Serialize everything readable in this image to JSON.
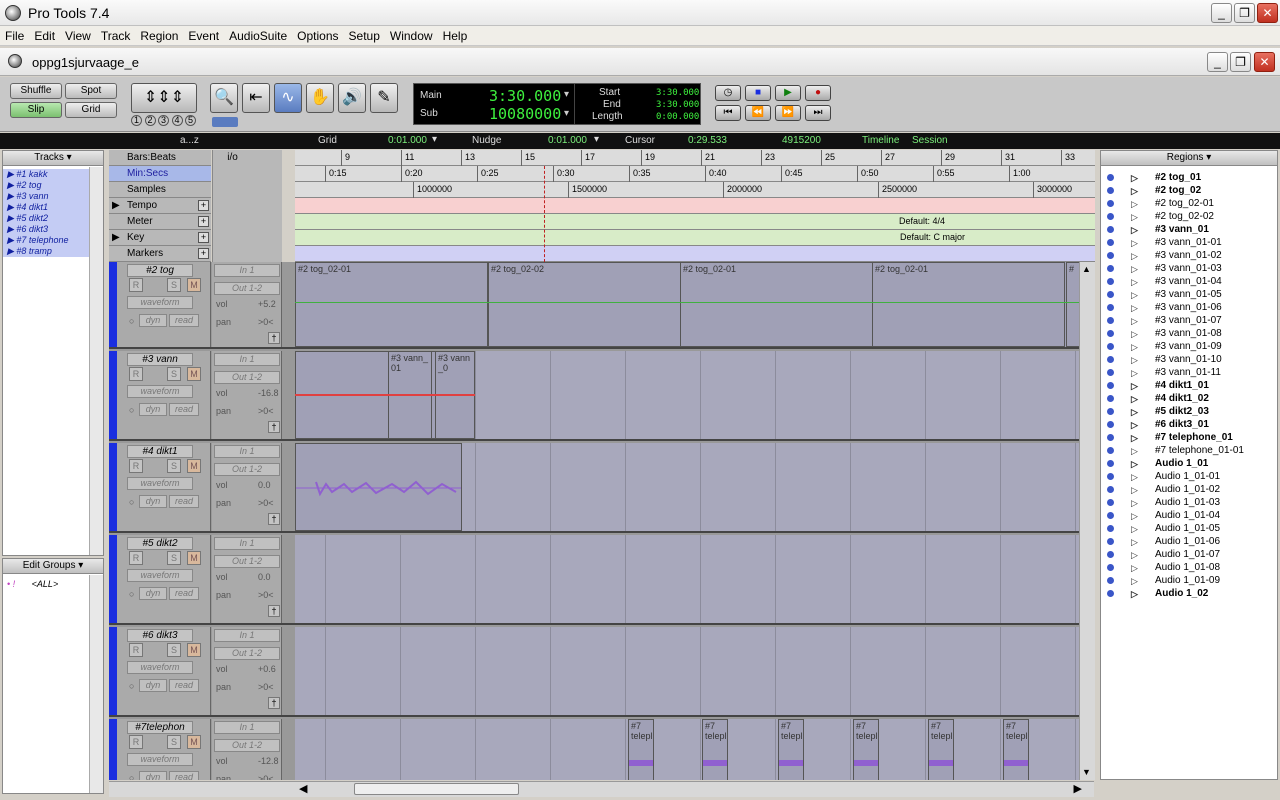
{
  "window": {
    "title": "Pro Tools 7.4"
  },
  "menu": [
    "File",
    "Edit",
    "View",
    "Track",
    "Region",
    "Event",
    "AudioSuite",
    "Options",
    "Setup",
    "Window",
    "Help"
  ],
  "session": {
    "title": "oppg1sjurvaage_e"
  },
  "modes": {
    "shuffle": "Shuffle",
    "spot": "Spot",
    "slip": "Slip",
    "grid": "Grid"
  },
  "zoom_presets": [
    "1",
    "2",
    "3",
    "4",
    "5"
  ],
  "counter": {
    "main_label": "Main",
    "main_value": "3:30.000",
    "sub_label": "Sub",
    "sub_value": "10080000",
    "start_label": "Start",
    "start_value": "3:30.000",
    "end_label": "End",
    "end_value": "3:30.000",
    "length_label": "Length",
    "length_value": "0:00.000"
  },
  "infobar": {
    "grid_label": "Grid",
    "grid_value": "0:01.000",
    "nudge_label": "Nudge",
    "nudge_value": "0:01.000",
    "cursor_label": "Cursor",
    "cursor_value": "0:29.533",
    "samples_value": "4915200",
    "timeline": "Timeline",
    "session": "Session",
    "az": "a...z"
  },
  "tracklist": {
    "header": "Tracks",
    "items": [
      "#1 kakk",
      "#2 tog",
      "#3 vann",
      "#4 dikt1",
      "#5 dikt2",
      "#6 dikt3",
      "#7 telephone",
      "#8 tramp"
    ]
  },
  "edit_groups": {
    "header": "Edit Groups",
    "item_id": "• !",
    "item_name": "<ALL>"
  },
  "rulers": {
    "bars_label": "Bars:Beats",
    "minsecs_label": "Min:Secs",
    "samples_label": "Samples",
    "tempo_label": "Tempo",
    "meter_label": "Meter",
    "key_label": "Key",
    "markers_label": "Markers",
    "io_label": "i/o",
    "bars": [
      "9",
      "11",
      "13",
      "15",
      "17",
      "19",
      "21",
      "23",
      "25",
      "27",
      "29",
      "31",
      "33"
    ],
    "minsecs": [
      "0:15",
      "0:20",
      "0:25",
      "0:30",
      "0:35",
      "0:40",
      "0:45",
      "0:50",
      "0:55",
      "1:00"
    ],
    "samples": [
      "1000000",
      "1500000",
      "2000000",
      "2500000",
      "3000000"
    ],
    "meter_default": "Default: 4/4",
    "key_default": "Default: C major"
  },
  "tracks": [
    {
      "name": "#2 tog",
      "input": "In 1",
      "output": "Out 1-2",
      "view": "waveform",
      "vol_label": "vol",
      "vol": "+5.2",
      "pan_label": "pan",
      "pan": ">0<",
      "dyn": "dyn",
      "auto": "read"
    },
    {
      "name": "#3 vann",
      "input": "In 1",
      "output": "Out 1-2",
      "view": "waveform",
      "vol_label": "vol",
      "vol": "-16.8",
      "pan_label": "pan",
      "pan": ">0<",
      "dyn": "dyn",
      "auto": "read"
    },
    {
      "name": "#4 dikt1",
      "input": "In 1",
      "output": "Out 1-2",
      "view": "waveform",
      "vol_label": "vol",
      "vol": "0.0",
      "pan_label": "pan",
      "pan": ">0<",
      "dyn": "dyn",
      "auto": "read"
    },
    {
      "name": "#5 dikt2",
      "input": "In 1",
      "output": "Out 1-2",
      "view": "waveform",
      "vol_label": "vol",
      "vol": "0.0",
      "pan_label": "pan",
      "pan": ">0<",
      "dyn": "dyn",
      "auto": "read"
    },
    {
      "name": "#6 dikt3",
      "input": "In 1",
      "output": "Out 1-2",
      "view": "waveform",
      "vol_label": "vol",
      "vol": "+0.6",
      "pan_label": "pan",
      "pan": ">0<",
      "dyn": "dyn",
      "auto": "read"
    },
    {
      "name": "#7telephon",
      "input": "In 1",
      "output": "Out 1-2",
      "view": "waveform",
      "vol_label": "vol",
      "vol": "-12.8",
      "pan_label": "pan",
      "pan": ">0<",
      "dyn": "dyn",
      "auto": "read"
    }
  ],
  "track_buttons": {
    "rec": "R",
    "solo": "S",
    "mute": "M"
  },
  "clips": {
    "tog": [
      "#2 tog_02-01",
      "#2 tog_02-02",
      "#2 tog_02-01",
      "#2 tog_02-01",
      "#"
    ],
    "vann": [
      "#3 vann_01",
      "#3 vann_0"
    ],
    "tele": [
      "#7 telepl",
      "#7 telepl",
      "#7 telepl",
      "#7 telepl",
      "#7 telepl",
      "#7 telepl"
    ]
  },
  "regions": {
    "header": "Regions",
    "items": [
      {
        "name": "#2 tog_01",
        "bold": true
      },
      {
        "name": "#2 tog_02",
        "bold": true
      },
      {
        "name": "#2 tog_02-01",
        "bold": false
      },
      {
        "name": "#2 tog_02-02",
        "bold": false
      },
      {
        "name": "#3 vann_01",
        "bold": true
      },
      {
        "name": "#3 vann_01-01",
        "bold": false
      },
      {
        "name": "#3 vann_01-02",
        "bold": false
      },
      {
        "name": "#3 vann_01-03",
        "bold": false
      },
      {
        "name": "#3 vann_01-04",
        "bold": false
      },
      {
        "name": "#3 vann_01-05",
        "bold": false
      },
      {
        "name": "#3 vann_01-06",
        "bold": false
      },
      {
        "name": "#3 vann_01-07",
        "bold": false
      },
      {
        "name": "#3 vann_01-08",
        "bold": false
      },
      {
        "name": "#3 vann_01-09",
        "bold": false
      },
      {
        "name": "#3 vann_01-10",
        "bold": false
      },
      {
        "name": "#3 vann_01-11",
        "bold": false
      },
      {
        "name": "#4 dikt1_01",
        "bold": true
      },
      {
        "name": "#4 dikt1_02",
        "bold": true
      },
      {
        "name": "#5 dikt2_03",
        "bold": true
      },
      {
        "name": "#6 dikt3_01",
        "bold": true
      },
      {
        "name": "#7 telephone_01",
        "bold": true
      },
      {
        "name": "#7 telephone_01-01",
        "bold": false
      },
      {
        "name": "Audio 1_01",
        "bold": true
      },
      {
        "name": "Audio 1_01-01",
        "bold": false
      },
      {
        "name": "Audio 1_01-02",
        "bold": false
      },
      {
        "name": "Audio 1_01-03",
        "bold": false
      },
      {
        "name": "Audio 1_01-04",
        "bold": false
      },
      {
        "name": "Audio 1_01-05",
        "bold": false
      },
      {
        "name": "Audio 1_01-06",
        "bold": false
      },
      {
        "name": "Audio 1_01-07",
        "bold": false
      },
      {
        "name": "Audio 1_01-08",
        "bold": false
      },
      {
        "name": "Audio 1_01-09",
        "bold": false
      },
      {
        "name": "Audio 1_02",
        "bold": true
      }
    ]
  },
  "colors": {
    "track": "#1a2ee0",
    "counter_text": "#3ef03e",
    "tempo_ruler": "#f8d0d0",
    "meter_ruler": "#d8ecc8",
    "markers_ruler": "#d0d0f4"
  }
}
